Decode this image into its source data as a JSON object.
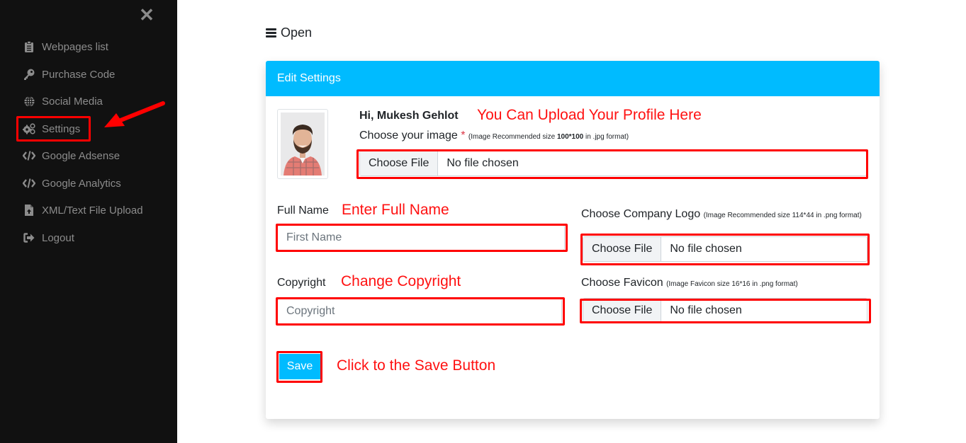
{
  "sidebar": {
    "close_label": "✕",
    "items": [
      {
        "label": "Webpages list",
        "icon": "clipboard-icon"
      },
      {
        "label": "Purchase Code",
        "icon": "key-icon"
      },
      {
        "label": "Social Media",
        "icon": "globe-icon"
      },
      {
        "label": "Settings",
        "icon": "gears-icon"
      },
      {
        "label": "Google Adsense",
        "icon": "code-icon"
      },
      {
        "label": "Google Analytics",
        "icon": "code-icon"
      },
      {
        "label": "XML/Text File Upload",
        "icon": "file-upload-icon"
      },
      {
        "label": "Logout",
        "icon": "sign-out-icon"
      }
    ]
  },
  "header": {
    "open_label": "Open"
  },
  "card": {
    "title": "Edit Settings",
    "greeting": "Hi, Mukesh Gehlot",
    "profile_image": {
      "label": "Choose your image",
      "required_mark": "*",
      "hint_pre": "(Image Recommended size ",
      "hint_bold": "100*100",
      "hint_post": " in .jpg format)",
      "button": "Choose File",
      "status": "No file chosen"
    },
    "full_name": {
      "label": "Full Name",
      "placeholder": "First Name",
      "value": ""
    },
    "copyright": {
      "label": "Copyright",
      "placeholder": "Copyright",
      "value": ""
    },
    "company_logo": {
      "label": "Choose Company Logo",
      "hint": "(Image Recommended size 114*44 in .png format)",
      "button": "Choose File",
      "status": "No file chosen"
    },
    "favicon": {
      "label": "Choose Favicon",
      "hint": "(Image Favicon size 16*16 in .png format)",
      "button": "Choose File",
      "status": "No file chosen"
    },
    "save_label": "Save"
  },
  "annotations": {
    "profile": "You Can Upload Your Profile Here",
    "full_name": "Enter Full Name",
    "copyright": "Change Copyright",
    "save": "Click to the Save Button"
  },
  "colors": {
    "accent": "#00bbff",
    "sidebar_bg": "#111111",
    "annotation": "#ff0000"
  }
}
